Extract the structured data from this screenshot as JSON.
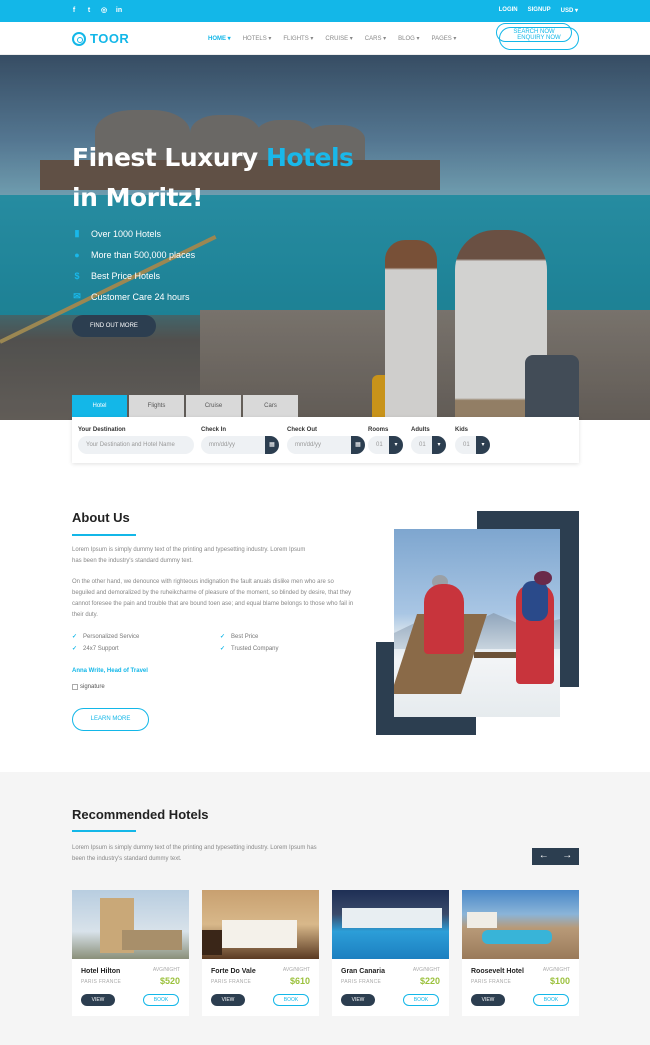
{
  "topbar": {
    "social": [
      {
        "icon": "facebook-icon",
        "glyph": "f"
      },
      {
        "icon": "twitter-icon",
        "glyph": "t"
      },
      {
        "icon": "instagram-icon",
        "glyph": "◎"
      },
      {
        "icon": "linkedin-icon",
        "glyph": "in"
      }
    ],
    "login": "LOGIN",
    "signup": "SIGNUP",
    "currency": "USD"
  },
  "nav": {
    "logo": "TOOR",
    "items": [
      "HOME",
      "HOTELS",
      "FLIGHTS",
      "CRUISE",
      "CARS",
      "BLOG",
      "PAGES"
    ],
    "enquiry": "ENQUIRY NOW"
  },
  "hero": {
    "title_line1": "Finest Luxury",
    "title_accent": "Hotels",
    "title_line2": "in Moritz!",
    "features": [
      {
        "icon": "bookmark-icon",
        "glyph": "▮",
        "text": "Over 1000 Hotels"
      },
      {
        "icon": "map-pin-icon",
        "glyph": "●",
        "text": "More than 500,000 places"
      },
      {
        "icon": "dollar-icon",
        "glyph": "$",
        "text": "Best Price Hotels"
      },
      {
        "icon": "chat-icon",
        "glyph": "✉",
        "text": "Customer Care 24 hours"
      }
    ],
    "cta": "FIND OUT MORE"
  },
  "search": {
    "tabs": [
      "Hotel",
      "Flights",
      "Cruise",
      "Cars"
    ],
    "destination_label": "Your Destination",
    "destination_placeholder": "Your Destination and Hotel Name",
    "checkin_label": "Check In",
    "checkout_label": "Check Out",
    "date_placeholder": "mm/dd/yy",
    "rooms_label": "Rooms",
    "adults_label": "Adults",
    "kids_label": "Kids",
    "rooms_value": "01",
    "adults_value": "01",
    "kids_value": "01",
    "button": "SEARCH NOW"
  },
  "about": {
    "title": "About Us",
    "para1": "Lorem Ipsum is simply dummy text of the printing and typesetting industry. Lorem Ipsum has been the industry's standard dummy text.",
    "para2": "On the other hand, we denounce with righteous indignation the fault anuals dislike men who are so beguiled and demoralized by the ruheikcharme of pleasure of the moment, so blinded by desire, that they cannot foresee the pain and trouble that are bound toen ase; and equal blame belongs to those who fail in their duty.",
    "checks": [
      "Personalized Service",
      "Best Price",
      "24x7 Support",
      "Trusted Company"
    ],
    "author": "Anna Write, Head of Travel",
    "signature_alt": "signature",
    "button": "LEARN MORE"
  },
  "recommended": {
    "title": "Recommended Hotels",
    "desc": "Lorem Ipsum is simply dummy text of the printing and typesetting industry. Lorem Ipsum has been the industry's standard dummy text.",
    "prev": "←",
    "next": "→",
    "avg_label": "AVG/NIGHT",
    "view": "VIEW",
    "book": "BOOK",
    "hotels": [
      {
        "name": "Hotel Hilton",
        "location": "PARIS FRANCE",
        "price": "$520"
      },
      {
        "name": "Forte Do Vale",
        "location": "PARIS FRANCE",
        "price": "$610"
      },
      {
        "name": "Gran Canaria",
        "location": "PARIS FRANCE",
        "price": "$220"
      },
      {
        "name": "Roosevelt Hotel",
        "location": "PARIS FRANCE",
        "price": "$100"
      }
    ]
  }
}
